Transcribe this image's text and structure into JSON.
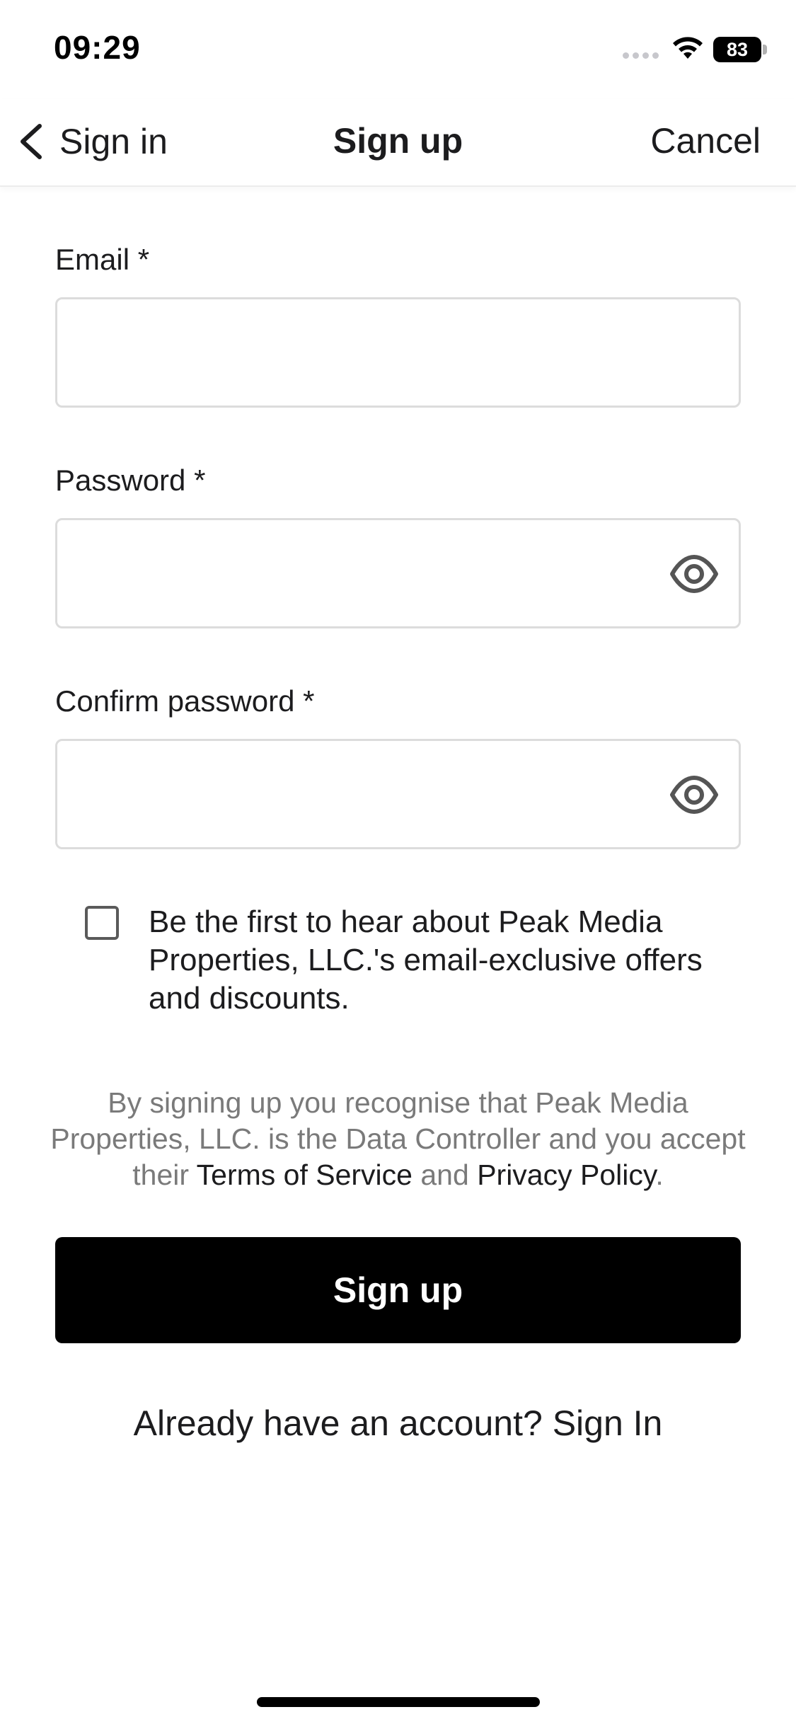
{
  "status_bar": {
    "time": "09:29",
    "battery": "83"
  },
  "nav": {
    "back_label": "Sign in",
    "title": "Sign up",
    "cancel_label": "Cancel"
  },
  "form": {
    "email": {
      "label": "Email *",
      "value": "",
      "placeholder": ""
    },
    "password": {
      "label": "Password *",
      "value": "",
      "placeholder": ""
    },
    "confirm_password": {
      "label": "Confirm password *",
      "value": "",
      "placeholder": ""
    },
    "marketing_opt_in": {
      "checked": false,
      "label": "Be the first to hear about Peak Media Properties, LLC.'s email-exclusive offers and discounts."
    }
  },
  "legal": {
    "prefix": "By signing up you recognise that Peak Media Properties, LLC. is the Data Controller and you accept their ",
    "terms_label": "Terms of Service",
    "conjunction": " and ",
    "privacy_label": "Privacy Policy",
    "suffix": "."
  },
  "signup_button_label": "Sign up",
  "signin_prompt": {
    "text": "Already have an account? ",
    "link_label": "Sign In"
  },
  "icons": {
    "back": "chevron-left-icon",
    "password_toggle": "eye-icon",
    "wifi": "wifi-icon",
    "battery": "battery-icon",
    "signal": "cellular-signal-icon"
  },
  "colors": {
    "primary_button": "#000000",
    "text": "#1c1c1e",
    "muted_text": "#7a7a7a",
    "field_border": "#dcdcdc"
  }
}
